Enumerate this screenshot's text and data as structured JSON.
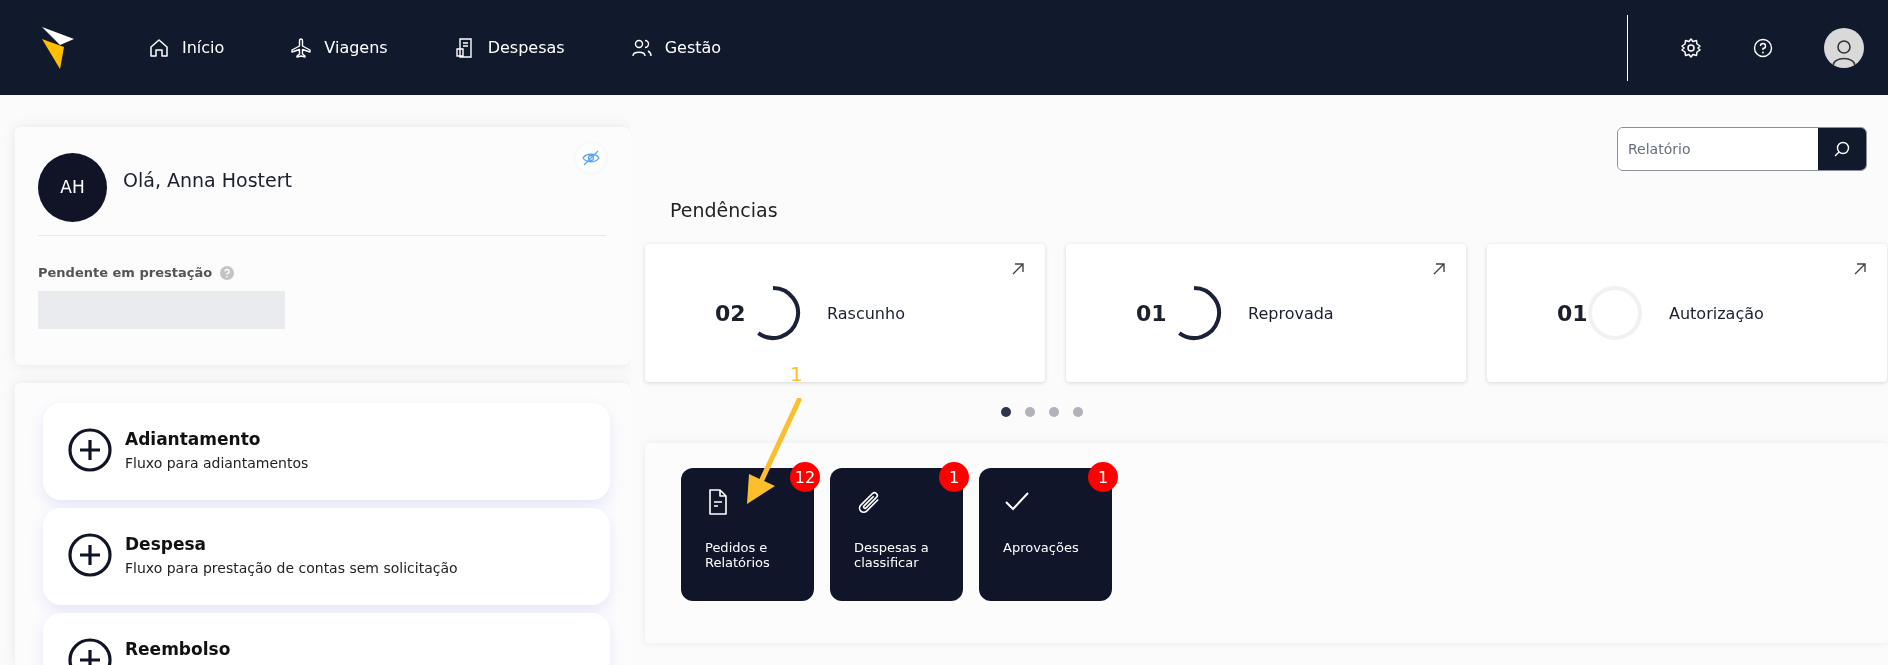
{
  "nav": {
    "items": [
      {
        "label": "Início"
      },
      {
        "label": "Viagens"
      },
      {
        "label": "Despesas"
      },
      {
        "label": "Gestão"
      }
    ]
  },
  "greeting": {
    "initials": "AH",
    "text": "Olá, Anna Hostert",
    "pending_label": "Pendente em prestação"
  },
  "actions": [
    {
      "title": "Adiantamento",
      "description": "Fluxo para adiantamentos"
    },
    {
      "title": "Despesa",
      "description": "Fluxo para prestação de contas sem solicitação"
    },
    {
      "title": "Reembolso"
    }
  ],
  "search": {
    "placeholder": "Relatório"
  },
  "pendencias": {
    "title": "Pendências",
    "cards": [
      {
        "count": "02",
        "label": "Rascunho",
        "ring_active": true
      },
      {
        "count": "01",
        "label": "Reprovada",
        "ring_active": true
      },
      {
        "count": "01",
        "label": "Autorização",
        "ring_active": false
      }
    ],
    "dots": [
      {
        "selected": true
      },
      {
        "selected": false
      },
      {
        "selected": false
      },
      {
        "selected": false
      }
    ]
  },
  "tiles": [
    {
      "label": "Pedidos e Relatórios",
      "badge": "12"
    },
    {
      "label": "Despesas a classificar",
      "badge": "1"
    },
    {
      "label": "Aprovações",
      "badge": "1"
    }
  ],
  "annotation": {
    "label": "1"
  }
}
